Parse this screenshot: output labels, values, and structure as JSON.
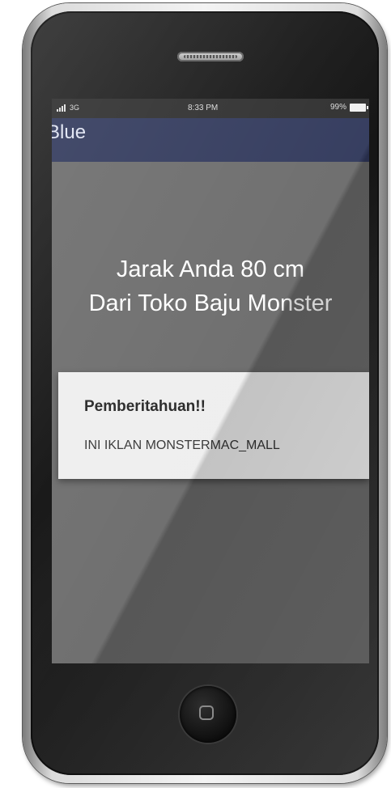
{
  "status_bar": {
    "network": "3G",
    "time": "8:33 PM",
    "battery": "99%"
  },
  "app_bar": {
    "title": "Blue"
  },
  "main": {
    "distance_line1": "Jarak Anda 80 cm",
    "distance_line2": "Dari Toko Baju Monster"
  },
  "dialog": {
    "title": "Pemberitahuan!!",
    "message": "INI IKLAN MONSTERMAC_MALL"
  },
  "icons": {
    "signal": "signal-icon",
    "battery": "battery-icon",
    "home": "home-button-icon"
  },
  "colors": {
    "app_bar": "#2f375a",
    "screen_background": "#6a6a6a",
    "dialog_background": "#eeeeee"
  }
}
